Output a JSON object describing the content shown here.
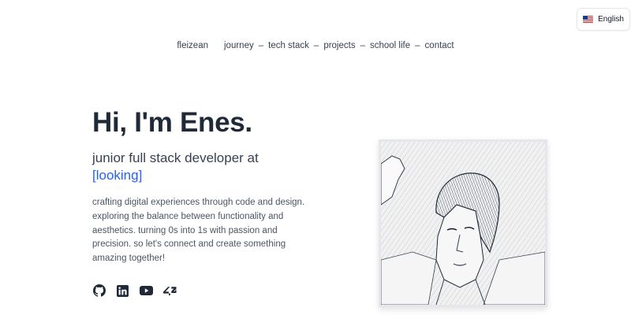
{
  "language": {
    "label": "English",
    "flag_icon": "us-flag-icon"
  },
  "nav": {
    "brand": "fleizean",
    "separator": "–",
    "items": [
      "journey",
      "tech stack",
      "projects",
      "school life",
      "contact"
    ]
  },
  "hero": {
    "title": "Hi, I'm Enes.",
    "subtitle": "junior full stack developer at",
    "highlight": "[looking]",
    "description": "crafting digital experiences through code and design. exploring the balance between functionality and aesthetics. turning 0s into 1s with passion and precision. so let's connect and create something amazing together!"
  },
  "socials": [
    "github-icon",
    "linkedin-icon",
    "youtube-icon",
    "42-icon"
  ],
  "colors": {
    "accent": "#2563eb",
    "text": "#1f2937",
    "muted": "#4b5563"
  }
}
